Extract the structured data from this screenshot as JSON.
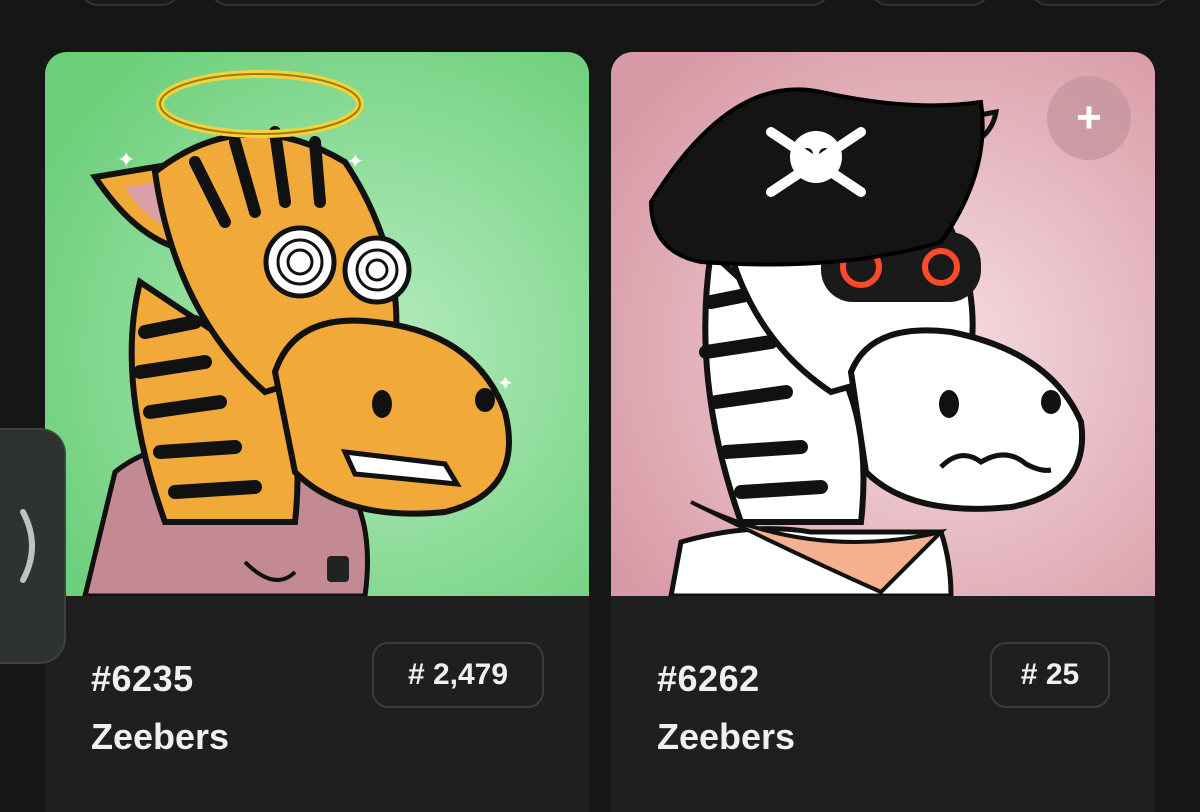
{
  "toolbar": {
    "pills": 4
  },
  "side_tab": {
    "icon": "chevron-right-icon"
  },
  "cards": [
    {
      "token_id": "#6235",
      "collection": "Zeebers",
      "rank": "# 2,479",
      "background": "#7fd68a",
      "subject": "orange striped zebra with halo and hypnotic eyes wearing pink hoodie"
    },
    {
      "token_id": "#6262",
      "collection": "Zeebers",
      "rank": "# 25",
      "background": "#e8b8c2",
      "subject": "white striped zebra with pirate hat, glowing red eyes and bandana",
      "add_button": "+"
    }
  ]
}
